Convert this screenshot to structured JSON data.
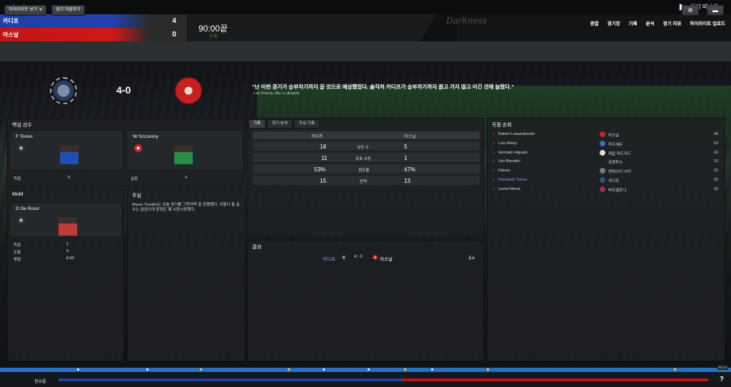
{
  "nav": {
    "back": "<",
    "forward": ">",
    "leave_label": "경기 떠나기"
  },
  "header": {
    "home_team": "카디프",
    "home_score": "4",
    "away_team": "아스날",
    "away_score": "0",
    "time": "90:00끝",
    "added_time": "(+1)",
    "brand": "Darkness",
    "menu": [
      "종합",
      "경기장",
      "기록",
      "분석",
      "경기 리뷰",
      "하이라이트 업로드"
    ]
  },
  "toolbar": {
    "highlights_label": "하이라이트 보기",
    "save_label": "경기 저장하기"
  },
  "summary": {
    "score": "4-0",
    "quote": "\"난 이번 경기가 승부차기까지 갈 것으로 예상했었다. 솔직히 카디프가 승부차기까지 끌고 가지 않고 이긴 것에 놀랐다.\"",
    "quote_source": "- Lee Francis, bbc.co.uk/sport"
  },
  "key_players": {
    "title": "핵심 선수",
    "home": {
      "name": "F Torres",
      "stat_label": "득점",
      "stat_value": "0"
    },
    "away": {
      "name": "W Szczesny",
      "stat_label": "실점",
      "stat_value": "4"
    }
  },
  "mom": {
    "title": "MoM",
    "name": "D De Rossi",
    "stats": [
      {
        "label": "득점",
        "value": "1"
      },
      {
        "label": "도움",
        "value": "0"
      },
      {
        "label": "평점",
        "value": "8.80"
      }
    ]
  },
  "referee": {
    "title": "주심",
    "text": "Mauro Tonolini는 오늘 경기를 그럭저럭 잘 진행했다. 이렇다 할 실수는 없었으며 판정은 꽤 시원시원했다."
  },
  "stats": {
    "tabs": [
      "기록",
      "경기 분석",
      "주요 기록"
    ],
    "home_team": "카디프",
    "away_team": "아스날",
    "rows": [
      {
        "label": "슈팅 수",
        "home": "18",
        "away": "5"
      },
      {
        "label": "유효 슈팅",
        "home": "11",
        "away": "1"
      },
      {
        "label": "점유율",
        "home": "53%",
        "away": "47%"
      },
      {
        "label": "반칙",
        "home": "15",
        "away": "13"
      }
    ]
  },
  "result": {
    "title": "결과",
    "home": "카디프",
    "score": "4 : 0",
    "away": "아스날",
    "status": "종료"
  },
  "scorers": {
    "title": "득점 순위",
    "rows": [
      {
        "name": "Robert Lewandowski",
        "club": "아스날",
        "goals": "18",
        "color": "#c22"
      },
      {
        "name": "Loïc Rémy",
        "club": "마르세유",
        "goals": "13",
        "color": "#3a6fc0"
      },
      {
        "name": "Gonzalo Higuaín",
        "club": "레알 마드리드",
        "goals": "13",
        "color": "#ddd"
      },
      {
        "name": "Léo Bonatini",
        "club": "유벤투스",
        "goals": "13",
        "color": "#222"
      },
      {
        "name": "Falcao",
        "club": "맨체스터 시티",
        "goals": "12",
        "color": "#777"
      },
      {
        "name": "Fernando Torres",
        "club": "카디프",
        "goals": "12",
        "color": "#3a4a80"
      },
      {
        "name": "Lionel Messi",
        "club": "바르셀로나",
        "goals": "10",
        "color": "#a22a5a"
      }
    ]
  },
  "bottom": {
    "possession_label": "점유율",
    "home_possession": 0.53,
    "clock": "90:13",
    "help": "?"
  }
}
